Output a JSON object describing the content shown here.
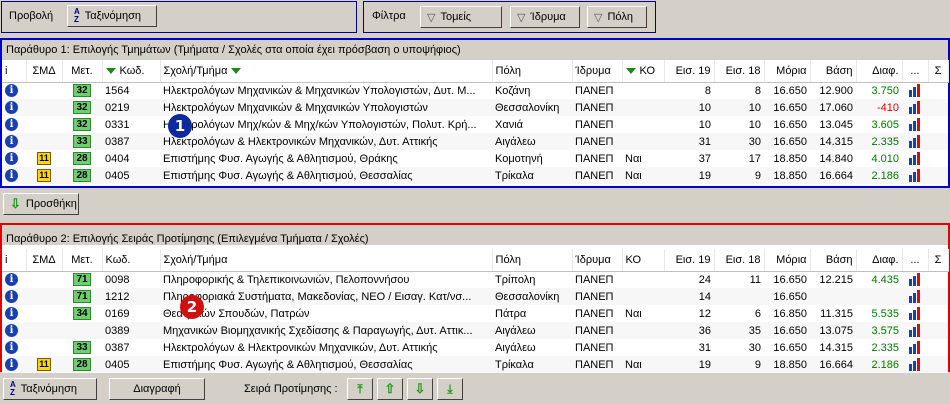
{
  "top": {
    "view_label": "Προβολή",
    "sort_label": "Ταξινόμηση",
    "filters_label": "Φίλτρα",
    "filter_buttons": [
      "Τομείς",
      "Ίδρυμα",
      "Πόλη"
    ]
  },
  "panel1": {
    "title": "Παράθυρο 1: Επιλογής Τμημάτων (Τμήματα / Σχολές στα οποία έχει πρόσβαση ο υποψήφιος)",
    "badge": "1",
    "columns": [
      "i",
      "ΣΜΔ",
      "Μετ.",
      "Κωδ.",
      "Σχολή/Τμήμα",
      "Πόλη",
      "Ίδρυμα",
      "ΚΟ",
      "Εισ. 19",
      "Εισ. 18",
      "Μόρια",
      "Βάση",
      "Διαφ.",
      "...",
      "Σ"
    ],
    "rows": [
      {
        "smd": "",
        "met": "32",
        "code": "1564",
        "school": "Ηλεκτρολόγων Μηχανικών & Μηχανικών Υπολογιστών, Δυτ. Μ...",
        "city": "Κοζάνη",
        "inst": "ΠΑΝΕΠ",
        "ko": "",
        "e19": "8",
        "e18": "8",
        "moria": "16.650",
        "vasi": "12.900",
        "diaf": "3.750",
        "sign": "pos"
      },
      {
        "smd": "",
        "met": "32",
        "code": "0219",
        "school": "Ηλεκτρολόγων Μηχανικών & Μηχανικών Υπολογιστών",
        "city": "Θεσσαλονίκη",
        "inst": "ΠΑΝΕΠ",
        "ko": "",
        "e19": "10",
        "e18": "10",
        "moria": "16.650",
        "vasi": "17.060",
        "diaf": "-410",
        "sign": "neg"
      },
      {
        "smd": "",
        "met": "32",
        "code": "0331",
        "school": "Ηλεκτρολόγων Μηχ/κών & Μηχ/κών Υπολογιστών, Πολυτ. Κρή...",
        "city": "Χανιά",
        "inst": "ΠΑΝΕΠ",
        "ko": "",
        "e19": "10",
        "e18": "10",
        "moria": "16.650",
        "vasi": "13.045",
        "diaf": "3.605",
        "sign": "pos"
      },
      {
        "smd": "",
        "met": "33",
        "code": "0387",
        "school": "Ηλεκτρολόγων & Ηλεκτρονικών Μηχανικών, Δυτ. Αττικής",
        "city": "Αιγάλεω",
        "inst": "ΠΑΝΕΠ",
        "ko": "",
        "e19": "31",
        "e18": "30",
        "moria": "16.650",
        "vasi": "14.315",
        "diaf": "2.335",
        "sign": "pos"
      },
      {
        "smd": "11",
        "met": "28",
        "code": "0404",
        "school": "Επιστήμης Φυσ. Αγωγής & Αθλητισμού, Θράκης",
        "city": "Κομοτηνή",
        "inst": "ΠΑΝΕΠ",
        "ko": "Ναι",
        "e19": "37",
        "e18": "17",
        "moria": "18.850",
        "vasi": "14.840",
        "diaf": "4.010",
        "sign": "pos"
      },
      {
        "smd": "11",
        "met": "28",
        "code": "0405",
        "school": "Επιστήμης Φυσ. Αγωγής & Αθλητισμού, Θεσσαλίας",
        "city": "Τρίκαλα",
        "inst": "ΠΑΝΕΠ",
        "ko": "Ναι",
        "e19": "19",
        "e18": "9",
        "moria": "18.850",
        "vasi": "16.664",
        "diaf": "2.186",
        "sign": "pos"
      }
    ]
  },
  "add_button": "Προσθήκη",
  "panel2": {
    "title": "Παράθυρο 2: Επιλογής Σειράς Προτίμησης (Επιλεγμένα Τμήματα / Σχολές)",
    "badge": "2",
    "columns": [
      "i",
      "ΣΜΔ",
      "Μετ.",
      "Κωδ.",
      "Σχολή/Τμήμα",
      "Πόλη",
      "Ίδρυμα",
      "ΚΟ",
      "Εισ. 19",
      "Εισ. 18",
      "Μόρια",
      "Βάση",
      "Διαφ.",
      "...",
      "Σ"
    ],
    "rows": [
      {
        "smd": "",
        "met": "71",
        "code": "0098",
        "school": "Πληροφορικής & Τηλεπικοινωνιών, Πελοποννήσου",
        "city": "Τρίπολη",
        "inst": "ΠΑΝΕΠ",
        "ko": "",
        "e19": "24",
        "e18": "11",
        "moria": "16.650",
        "vasi": "12.215",
        "diaf": "4.435",
        "sign": "pos"
      },
      {
        "smd": "",
        "met": "71",
        "code": "1212",
        "school": "Πληροφοριακά Συστήματα, Μακεδονίας, ΝΕΟ / Εισαγ. Κατ/νσ...",
        "city": "Θεσσαλονίκη",
        "inst": "ΠΑΝΕΠ",
        "ko": "",
        "e19": "14",
        "e18": "",
        "moria": "16.650",
        "vasi": "",
        "diaf": "",
        "sign": "pos"
      },
      {
        "smd": "",
        "met": "34",
        "code": "0169",
        "school": "Θεατρικών Σπουδών, Πατρών",
        "city": "Πάτρα",
        "inst": "ΠΑΝΕΠ",
        "ko": "Ναι",
        "e19": "12",
        "e18": "6",
        "moria": "16.850",
        "vasi": "11.315",
        "diaf": "5.535",
        "sign": "pos"
      },
      {
        "smd": "",
        "met": "",
        "code": "0389",
        "school": "Μηχανικών Βιομηχανικής Σχεδίασης & Παραγωγής, Δυτ. Αττικ...",
        "city": "Αιγάλεω",
        "inst": "ΠΑΝΕΠ",
        "ko": "",
        "e19": "36",
        "e18": "35",
        "moria": "16.650",
        "vasi": "13.075",
        "diaf": "3.575",
        "sign": "pos"
      },
      {
        "smd": "",
        "met": "33",
        "code": "0387",
        "school": "Ηλεκτρολόγων & Ηλεκτρονικών Μηχανικών, Δυτ. Αττικής",
        "city": "Αιγάλεω",
        "inst": "ΠΑΝΕΠ",
        "ko": "",
        "e19": "31",
        "e18": "30",
        "moria": "16.650",
        "vasi": "14.315",
        "diaf": "2.335",
        "sign": "pos"
      },
      {
        "smd": "11",
        "met": "28",
        "code": "0405",
        "school": "Επιστήμης Φυσ. Αγωγής & Αθλητισμού, Θεσσαλίας",
        "city": "Τρίκαλα",
        "inst": "ΠΑΝΕΠ",
        "ko": "Ναι",
        "e19": "19",
        "e18": "9",
        "moria": "18.850",
        "vasi": "16.664",
        "diaf": "2.186",
        "sign": "pos"
      }
    ]
  },
  "bottom": {
    "sort_label": "Ταξινόμηση",
    "delete_label": "Διαγραφή",
    "order_label": "Σειρά Προτίμησης :"
  },
  "colors": {
    "panel1_border": "#0000c8",
    "panel2_border": "#e00000",
    "positive": "#007a00",
    "negative": "#e00000"
  }
}
